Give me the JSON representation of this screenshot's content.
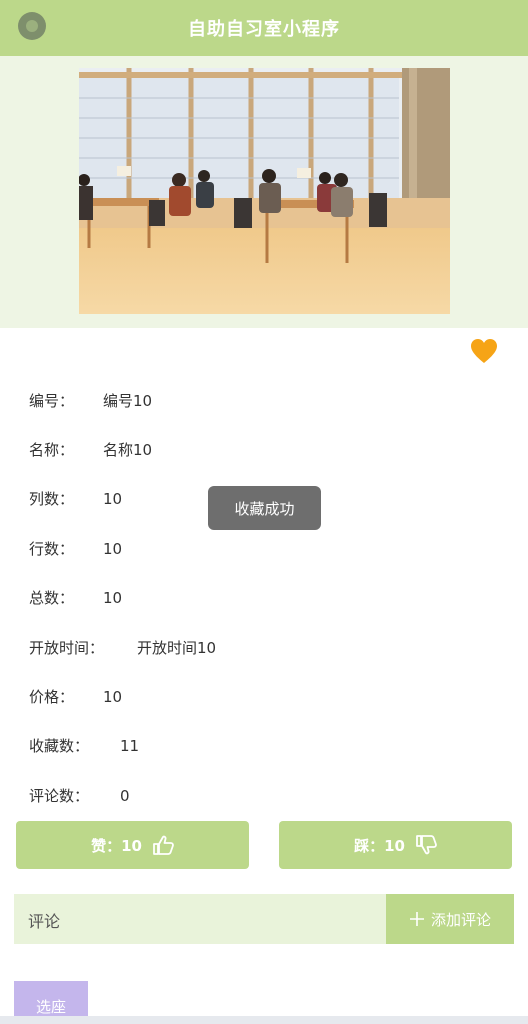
{
  "header": {
    "title": "自助自习室小程序"
  },
  "details": [
    {
      "label": "编号：",
      "value": "编号10"
    },
    {
      "label": "名称：",
      "value": "名称10"
    },
    {
      "label": "列数：",
      "value": "10"
    },
    {
      "label": "行数：",
      "value": "10"
    },
    {
      "label": "总数：",
      "value": "10"
    },
    {
      "label": "开放时间：",
      "value": "开放时间10"
    },
    {
      "label": "价格：",
      "value": "10"
    },
    {
      "label": "收藏数：",
      "value": "11"
    },
    {
      "label": "评论数：",
      "value": "0"
    }
  ],
  "toast": "收藏成功",
  "votes": {
    "like_label": "赞：10",
    "dislike_label": "踩：10"
  },
  "comments": {
    "label": "评论",
    "add_label": "添加评论"
  },
  "select_button": "选座",
  "colors": {
    "brand": "#bcd88a",
    "favorite": "#f6a416",
    "select": "#c4b6ec"
  }
}
